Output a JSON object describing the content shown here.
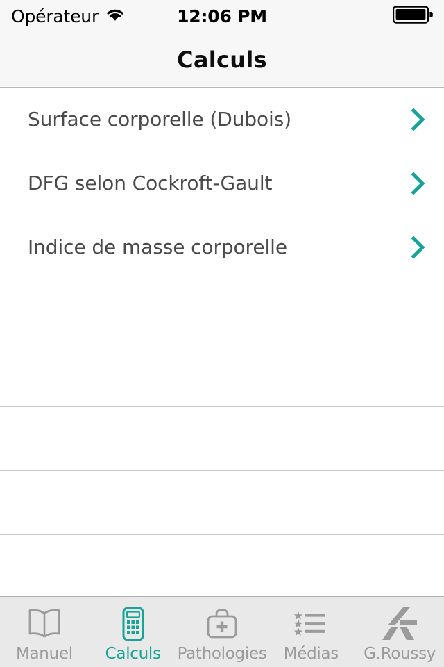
{
  "status_bar": {
    "carrier": "Opérateur",
    "wifi_icon": "wifi-icon",
    "time": "12:06 PM",
    "battery_icon": "battery-full-icon"
  },
  "navbar": {
    "title": "Calculs"
  },
  "theme": {
    "accent": "#17a398",
    "text": "#4a4a4a",
    "inactive_tab": "#9b9b9b",
    "separator": "#c8c8c8",
    "bar_background": "#f7f7f7",
    "tabbar_background": "#e9e9e9",
    "content_background": "#ffffff"
  },
  "list": {
    "items": [
      {
        "label": "Surface corporelle (Dubois)",
        "accessory_icon": "chevron-right-icon"
      },
      {
        "label": "DFG selon Cockroft-Gault",
        "accessory_icon": "chevron-right-icon"
      },
      {
        "label": "Indice de masse corporelle",
        "accessory_icon": "chevron-right-icon"
      }
    ],
    "empty_rows": 5
  },
  "tabbar": {
    "active_index": 1,
    "items": [
      {
        "label": "Manuel",
        "icon": "book-icon"
      },
      {
        "label": "Calculs",
        "icon": "calculator-icon"
      },
      {
        "label": "Pathologies",
        "icon": "medical-bag-icon"
      },
      {
        "label": "Médias",
        "icon": "starred-list-icon"
      },
      {
        "label": "G.Roussy",
        "icon": "gustave-roussy-logo-icon"
      }
    ]
  }
}
